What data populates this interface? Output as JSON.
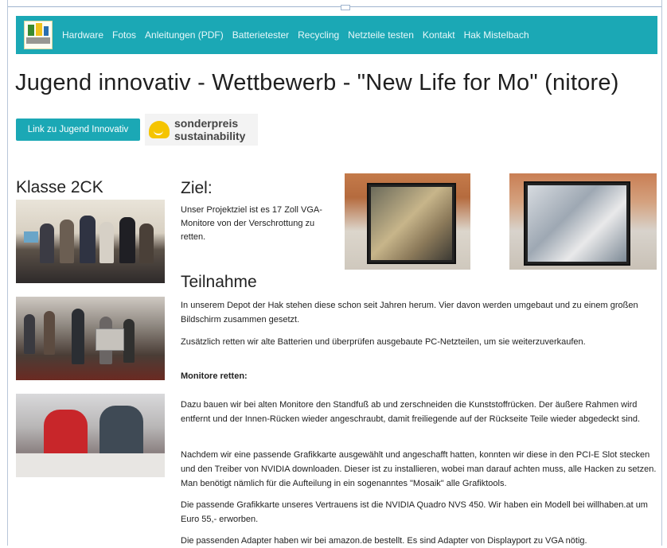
{
  "nav": {
    "items": [
      "Hardware",
      "Fotos",
      "Anleitungen (PDF)",
      "Batterietester",
      "Recycling",
      "Netzteile testen",
      "Kontakt",
      "Hak Mistelbach"
    ]
  },
  "page": {
    "title": "Jugend innovativ - Wettbewerb - \"New Life for Mo\" (nitore)",
    "link_button": "Link zu Jugend Innovativ",
    "badge": {
      "line1": "sonderpreis",
      "line2": "sustainability"
    }
  },
  "sidebar": {
    "heading": "Klasse 2CK"
  },
  "ziel": {
    "heading": "Ziel:",
    "text": "Unser Projektziel ist es 17 Zoll VGA-Monitore von der Verschrottung zu retten."
  },
  "teilnahme": {
    "heading": "Teilnahme",
    "p1": "In unserem Depot der Hak stehen diese schon seit Jahren herum. Vier davon werden umgebaut und zu einem großen Bildschirm zusammen gesetzt.",
    "p2": "Zusätzlich retten wir alte Batterien und überprüfen ausgebaute PC-Netzteilen, um sie weiterzuverkaufen."
  },
  "monitore": {
    "heading": "Monitore retten:",
    "p1": "Dazu bauen wir bei alten Monitore den Standfuß ab und zerschneiden die Kunststoffrücken. Der äußere Rahmen wird entfernt und der Innen-Rücken wieder angeschraubt, damit freiliegende auf der Rückseite Teile wieder abgedeckt sind.",
    "p2": "Nachdem wir eine passende Grafikkarte ausgewählt und angeschafft hatten, konnten wir diese in den PCI-E Slot stecken und den Treiber von NVIDIA downloaden. Dieser ist zu installieren, wobei man darauf achten muss, alle Hacken zu setzen. Man benötigt nämlich für die Aufteilung in ein sogenanntes \"Mosaik\" alle Grafiktools.",
    "p3": "Die passende Grafikkarte unseres Vertrauens ist die NVIDIA Quadro NVS 450. Wir haben ein Modell bei willhaben.at um Euro 55,- erworben.",
    "p4": "Die passenden Adapter haben wir bei amazon.de bestellt. Es sind Adapter von Displayport zu VGA nötig."
  },
  "colors": {
    "accent": "#1ba8b5",
    "badge_yellow": "#f5c400"
  }
}
